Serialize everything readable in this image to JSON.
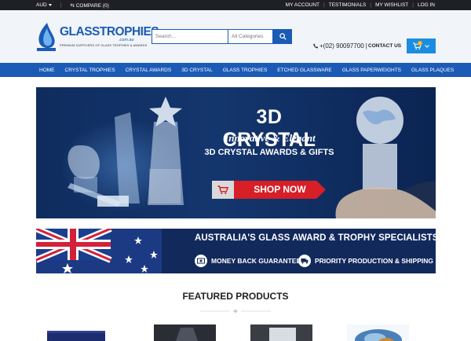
{
  "topbar": {
    "currency": "AUD",
    "compare": "COMPARE (0)",
    "links": [
      "MY ACCOUNT",
      "TESTIMONIALS",
      "MY WISHLIST",
      "LOG IN"
    ]
  },
  "logo": {
    "name": "GLASSTROPHIES",
    "domain": ".com.au",
    "tagline": "PREMIUM SUPPLIERS OF GLASS TROPHIES & AWARDS"
  },
  "search": {
    "placeholder": "Search...",
    "category": "All Categories"
  },
  "contact": {
    "phone": "+(02) 90097700",
    "label": "CONTACT US"
  },
  "cart": {
    "count": "0"
  },
  "nav": [
    "HOME",
    "CRYSTAL TROPHIES",
    "CRYSTAL AWARDS",
    "3D CRYSTAL",
    "GLASS TROPHIES",
    "ETCHED GLASSWARE",
    "GLASS PAPERWEIGHTS",
    "GLASS PLAQUES"
  ],
  "hero": {
    "title": "3D CRYSTAL",
    "subtitle": "Innovative & Elegant",
    "line": "3D CRYSTAL AWARDS & GIFTS",
    "cta": "SHOP NOW"
  },
  "banner2": {
    "title": "AUSTRALIA'S GLASS AWARD & TROPHY SPECIALISTS",
    "feature1": "MONEY BACK GUARANTEE",
    "feature2": "PRIORITY PRODUCTION & SHIPPING"
  },
  "featured": {
    "title": "FEATURED PRODUCTS"
  },
  "colors": {
    "primary": "#1b5bb5",
    "topbar": "#1f1f26",
    "cart": "#1b8de0",
    "cta": "#d61f26",
    "header_bg": "#f1f4f9"
  }
}
